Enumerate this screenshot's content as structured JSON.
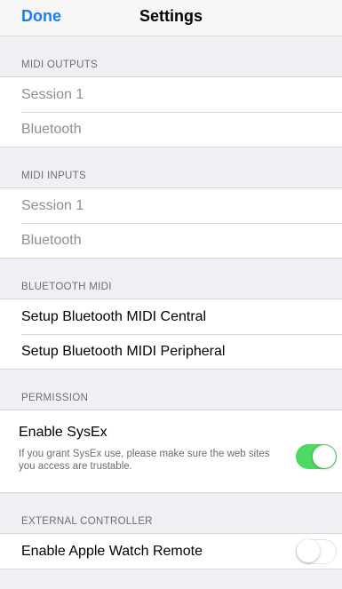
{
  "navbar": {
    "done_label": "Done",
    "title": "Settings"
  },
  "midi_outputs": {
    "header": "MIDI OUTPUTS",
    "items": [
      "Session 1",
      "Bluetooth"
    ]
  },
  "midi_inputs": {
    "header": "MIDI INPUTS",
    "items": [
      "Session 1",
      "Bluetooth"
    ]
  },
  "bluetooth_midi": {
    "header": "BLUETOOTH MIDI",
    "items": [
      "Setup Bluetooth MIDI Central",
      "Setup Bluetooth MIDI Peripheral"
    ]
  },
  "permission": {
    "header": "PERMISSION",
    "title": "Enable SysEx",
    "description": "If you grant SysEx use, please make sure the web sites you access are trustable.",
    "enabled": true
  },
  "external_controller": {
    "header": "EXTERNAL CONTROLLER",
    "title": "Enable Apple Watch Remote",
    "enabled": false
  },
  "colors": {
    "accent": "#1c7cf2",
    "switch_on": "#4cd964",
    "background": "#efeff4"
  }
}
